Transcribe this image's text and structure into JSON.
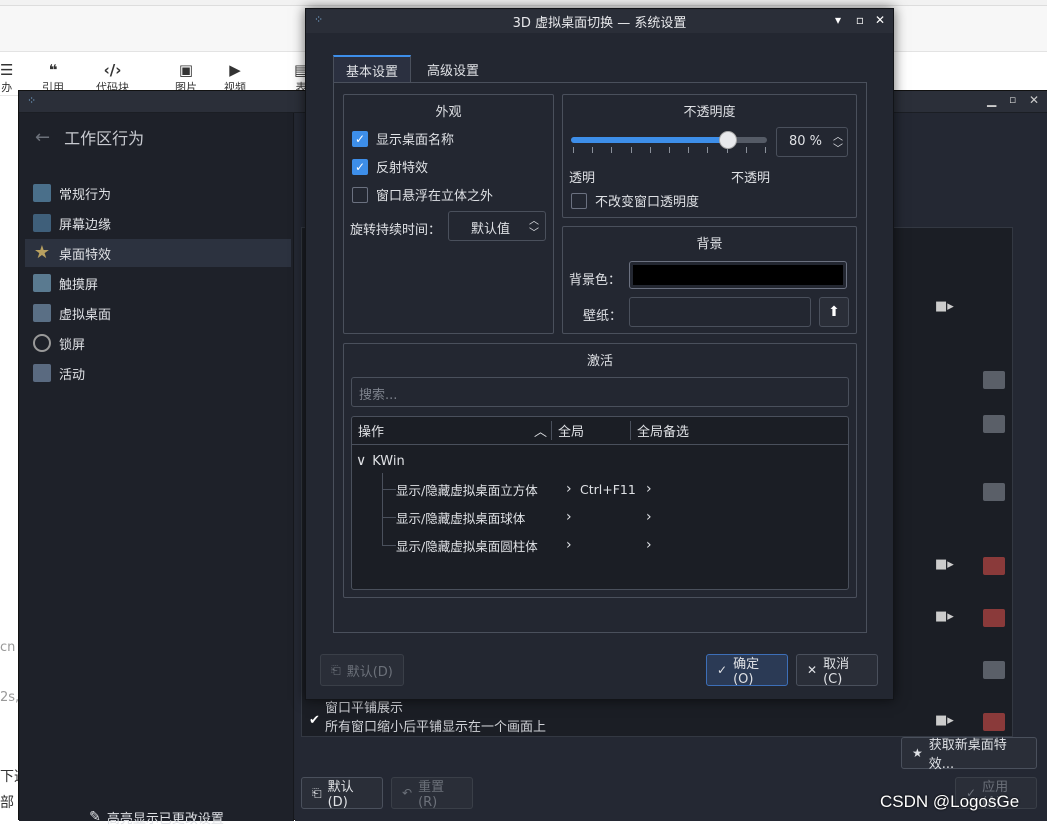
{
  "editor": {
    "toolbar": [
      {
        "icon": "☰",
        "label": "办"
      },
      {
        "icon": "❝",
        "label": "引用"
      },
      {
        "icon": "‹/›",
        "label": "代码块"
      },
      {
        "icon": "▣",
        "label": "图片"
      },
      {
        "icon": "▶",
        "label": "视频"
      },
      {
        "icon": "▤",
        "label": "表"
      }
    ],
    "left_fragments": [
      "cn",
      "2s,",
      "下这",
      "部"
    ]
  },
  "workspace": {
    "title": "工作区行为",
    "side_items": [
      {
        "label": "常规行为",
        "icon": "general-behavior-icon",
        "color": "#4a6f8a"
      },
      {
        "label": "屏幕边缘",
        "icon": "screen-edges-icon",
        "color": "#3f5f7a"
      },
      {
        "label": "桌面特效",
        "icon": "star-icon",
        "color": "#b8a060"
      },
      {
        "label": "触摸屏",
        "icon": "touchscreen-icon",
        "color": "#5a7a90"
      },
      {
        "label": "虚拟桌面",
        "icon": "virtual-desktop-icon",
        "color": "#5a6f85"
      },
      {
        "label": "锁屏",
        "icon": "lock-screen-icon",
        "color": "#888"
      },
      {
        "label": "活动",
        "icon": "activities-icon",
        "color": "#5a6a80"
      }
    ],
    "highlight_label": "高亮显示已更改设置",
    "effect_row": {
      "title": "窗口平铺展示",
      "desc": "所有窗口缩小后平铺显示在一个画面上"
    },
    "get_new_label": "获取新桌面特效...",
    "default_label": "默认(D)",
    "reset_label": "重置(R)",
    "apply_label": "应用(A)"
  },
  "dialog": {
    "title": "3D 虚拟桌面切换 — 系统设置",
    "tabs": [
      "基本设置",
      "高级设置"
    ],
    "appearance": {
      "title": "外观",
      "options": [
        {
          "label": "显示桌面名称",
          "checked": true
        },
        {
          "label": "反射特效",
          "checked": true
        },
        {
          "label": "窗口悬浮在立体之外",
          "checked": false
        }
      ],
      "duration_label": "旋转持续时间：",
      "duration_value": "默认值"
    },
    "opacity": {
      "title": "不透明度",
      "value": 0.8,
      "value_text": "80 %",
      "min_label": "透明",
      "max_label": "不透明",
      "keep_label": "不改变窗口透明度",
      "keep_checked": false
    },
    "background": {
      "title": "背景",
      "color_label": "背景色：",
      "color": "#000000",
      "wallpaper_label": "壁纸：",
      "wallpaper_value": ""
    },
    "activation": {
      "title": "激活",
      "search_placeholder": "搜索...",
      "columns": [
        "操作",
        "全局",
        "全局备选"
      ],
      "group": "KWin",
      "rows": [
        {
          "action": "显示/隐藏虚拟桌面立方体",
          "shortcut": "Ctrl+F11"
        },
        {
          "action": "显示/隐藏虚拟桌面球体",
          "shortcut": ""
        },
        {
          "action": "显示/隐藏虚拟桌面圆柱体",
          "shortcut": ""
        }
      ]
    },
    "default_btn": "默认(D)",
    "ok_btn": "确定(O)",
    "cancel_btn": "取消(C)"
  },
  "watermark": "CSDN @LogosGe",
  "colors": {
    "accent": "#3d8ee9",
    "bg": "#232731"
  }
}
